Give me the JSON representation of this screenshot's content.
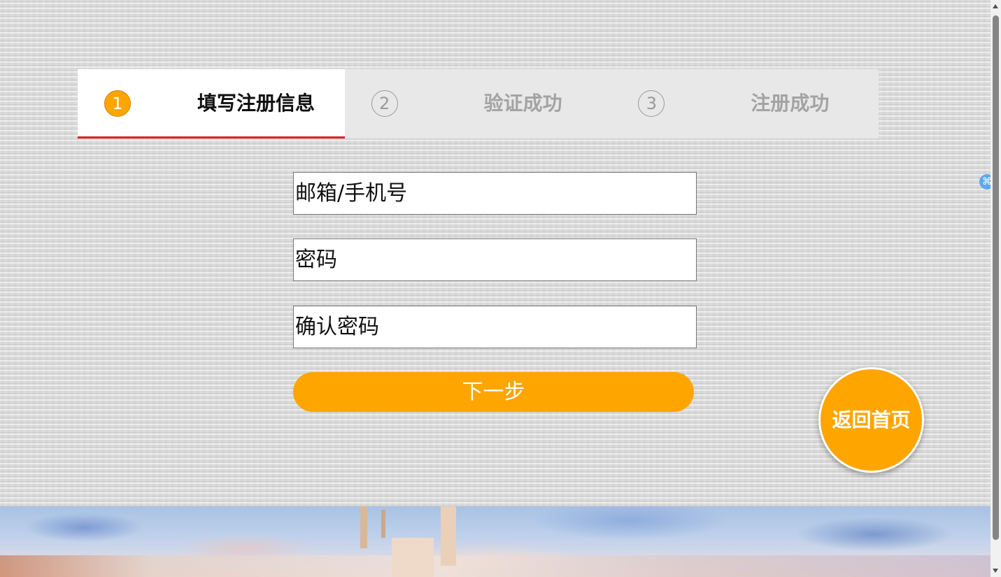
{
  "steps": [
    {
      "number": "1",
      "label": "填写注册信息",
      "active": true
    },
    {
      "number": "2",
      "label": "验证成功",
      "active": false
    },
    {
      "number": "3",
      "label": "注册成功",
      "active": false
    }
  ],
  "form": {
    "account_placeholder": "邮箱/手机号",
    "password_placeholder": "密码",
    "confirm_placeholder": "确认密码",
    "next_label": "下一步"
  },
  "home_button": {
    "label": "返回首页"
  },
  "side_icon": {
    "glyph": "⌘",
    "icon": "extension-icon"
  },
  "colors": {
    "accent": "#ffa500",
    "active_underline": "#e02020",
    "inactive_text": "#a3a3a3"
  }
}
